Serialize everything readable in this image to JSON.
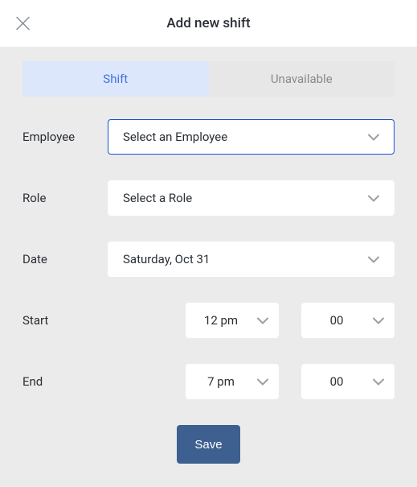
{
  "header": {
    "title": "Add new shift"
  },
  "tabs": {
    "shift": "Shift",
    "unavailable": "Unavailable"
  },
  "labels": {
    "employee": "Employee",
    "role": "Role",
    "date": "Date",
    "start": "Start",
    "end": "End"
  },
  "fields": {
    "employee_placeholder": "Select an Employee",
    "role_placeholder": "Select a Role",
    "date_value": "Saturday, Oct 31",
    "start_hour": "12 pm",
    "start_minute": "00",
    "end_hour": "7 pm",
    "end_minute": "00"
  },
  "buttons": {
    "save": "Save"
  }
}
